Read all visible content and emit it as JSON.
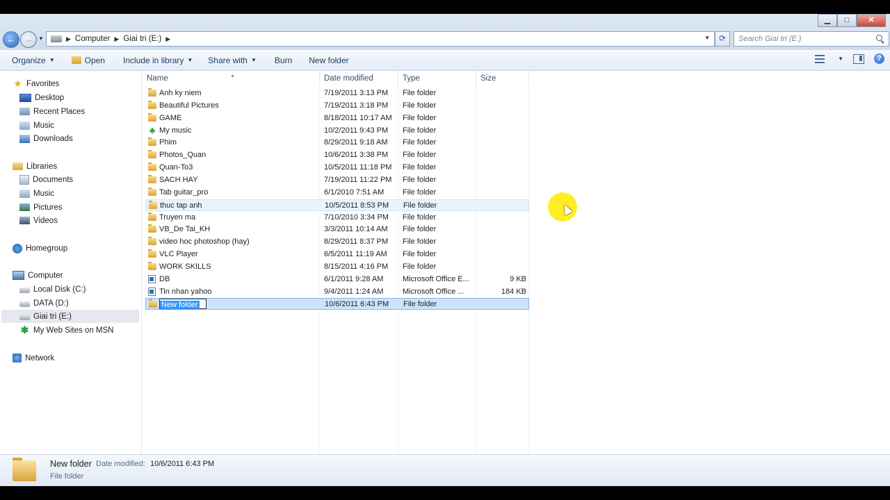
{
  "window": {
    "controls": {
      "minimize": "▁",
      "maximize": "□",
      "close": "✕"
    }
  },
  "address_bar": {
    "crumbs": [
      "Computer",
      "Giai tri (E:)"
    ],
    "search_placeholder": "Search Giai tri (E:)"
  },
  "toolbar": {
    "organize": "Organize",
    "open": "Open",
    "include_in_library": "Include in library",
    "share_with": "Share with",
    "burn": "Burn",
    "new_folder": "New folder",
    "help": "?"
  },
  "sidebar": {
    "favorites": {
      "label": "Favorites",
      "items": [
        "Desktop",
        "Recent Places",
        "Music",
        "Downloads"
      ]
    },
    "libraries": {
      "label": "Libraries",
      "items": [
        "Documents",
        "Music",
        "Pictures",
        "Videos"
      ]
    },
    "homegroup": "Homegroup",
    "computer": {
      "label": "Computer",
      "items": [
        "Local Disk (C:)",
        "DATA (D:)",
        "Giai tri (E:)",
        "My Web Sites on MSN"
      ]
    },
    "network": "Network"
  },
  "columns": {
    "name": "Name",
    "date": "Date modified",
    "type": "Type",
    "size": "Size"
  },
  "files": [
    {
      "name": "Anh ky niem",
      "date": "7/19/2011 3:13 PM",
      "type": "File folder",
      "size": "",
      "icon": "folder-icon"
    },
    {
      "name": "Beautiful Pictures",
      "date": "7/19/2011 3:18 PM",
      "type": "File folder",
      "size": "",
      "icon": "folder-icon"
    },
    {
      "name": "GAME",
      "date": "8/18/2011 10:17 AM",
      "type": "File folder",
      "size": "",
      "icon": "folder-icon"
    },
    {
      "name": "My music",
      "date": "10/2/2011 9:43 PM",
      "type": "File folder",
      "size": "",
      "icon": "tree-icon"
    },
    {
      "name": "Phim",
      "date": "8/29/2011 9:18 AM",
      "type": "File folder",
      "size": "",
      "icon": "folder-icon"
    },
    {
      "name": "Photos_Quan",
      "date": "10/6/2011 3:38 PM",
      "type": "File folder",
      "size": "",
      "icon": "folder-icon"
    },
    {
      "name": "Quan-To3",
      "date": "10/5/2011 11:18 PM",
      "type": "File folder",
      "size": "",
      "icon": "folder-icon"
    },
    {
      "name": "SACH HAY",
      "date": "7/19/2011 11:22 PM",
      "type": "File folder",
      "size": "",
      "icon": "folder-icon"
    },
    {
      "name": "Tab guitar_pro",
      "date": "6/1/2010 7:51 AM",
      "type": "File folder",
      "size": "",
      "icon": "folder-icon"
    },
    {
      "name": "thuc tap anh",
      "date": "10/5/2011 8:53 PM",
      "type": "File folder",
      "size": "",
      "icon": "folder-icon"
    },
    {
      "name": "Truyen ma",
      "date": "7/10/2010 3:34 PM",
      "type": "File folder",
      "size": "",
      "icon": "folder-icon"
    },
    {
      "name": "VB_De Tai_KH",
      "date": "3/3/2011 10:14 AM",
      "type": "File folder",
      "size": "",
      "icon": "folder-icon"
    },
    {
      "name": "video hoc photoshop (hay)",
      "date": "8/29/2011 8:37 PM",
      "type": "File folder",
      "size": "",
      "icon": "folder-icon"
    },
    {
      "name": "VLC Player",
      "date": "6/5/2011 11:19 AM",
      "type": "File folder",
      "size": "",
      "icon": "folder-icon"
    },
    {
      "name": "WORK SKILLS",
      "date": "8/15/2011 4:16 PM",
      "type": "File folder",
      "size": "",
      "icon": "folder-icon"
    },
    {
      "name": "DB",
      "date": "6/1/2011 9:28 AM",
      "type": "Microsoft Office E...",
      "size": "9 KB",
      "icon": "office-file-icon"
    },
    {
      "name": "Tin nhan yahoo",
      "date": "9/4/2011 1:24 AM",
      "type": "Microsoft Office ...",
      "size": "184 KB",
      "icon": "office-file-icon"
    },
    {
      "name": "New folder",
      "date": "10/6/2011 6:43 PM",
      "type": "File folder",
      "size": "",
      "icon": "folder-icon"
    }
  ],
  "details_pane": {
    "name": "New folder",
    "date_label": "Date modified:",
    "date_value": "10/6/2011 6:43 PM",
    "type": "File folder"
  }
}
